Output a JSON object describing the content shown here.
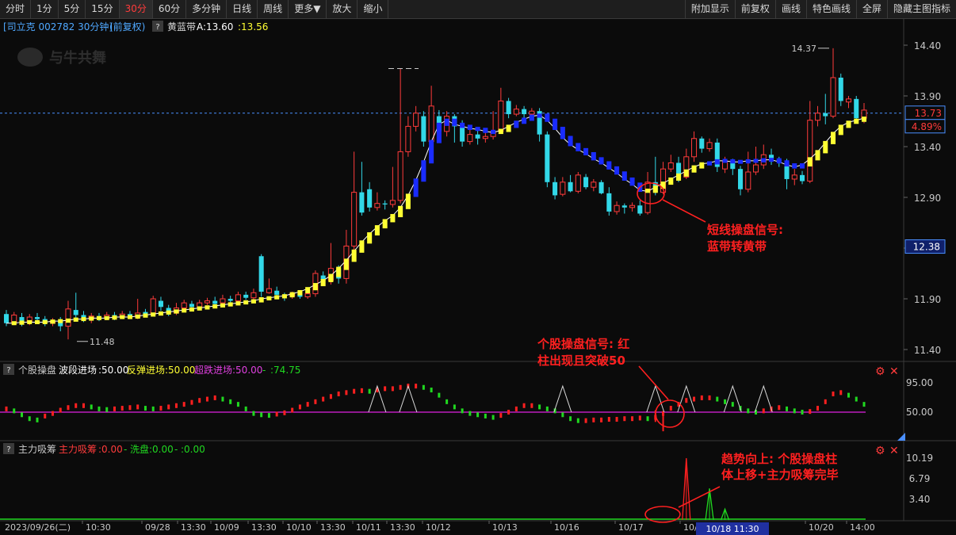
{
  "toolbar": {
    "left": [
      "分时",
      "1分",
      "5分",
      "15分",
      "30分",
      "60分",
      "多分钟",
      "日线",
      "周线",
      "更多▼",
      "放大",
      "缩小"
    ],
    "active": "30分",
    "right": [
      "附加显示",
      "前复权",
      "画线",
      "特色画线",
      "全屏",
      "隐藏主图指标"
    ]
  },
  "header": {
    "stock": "[司立克 002782 30分钟]",
    "adjust": "(前复权)",
    "qmark": "?",
    "indicator_name": "黄蓝带",
    "a_label": "A:13.60",
    "b_value": ":13.56"
  },
  "watermark": "与牛共舞",
  "price_axis": {
    "ticks": [
      "14.40",
      "13.90",
      "13.40",
      "12.90",
      "12.40",
      "11.90",
      "11.40"
    ],
    "current_price": "13.73",
    "change_pct": "4.89%",
    "marker_price": "12.38",
    "high_label": "14.37",
    "low_label": "11.48"
  },
  "osc_panel": {
    "qmark": "?",
    "name": "个股操盘",
    "p1_label": "波段进场",
    "p1_value": ":50.00",
    "p2_label": "反弹进场",
    "p2_value": ":50.00",
    "p3_label": "超跌进场",
    "p3_value": ":50.00",
    "p4_value": ":74.75",
    "ticks": [
      "95.00",
      "50.00"
    ]
  },
  "chip_panel": {
    "qmark": "?",
    "name": "主力吸筹",
    "p1_label": "主力吸筹",
    "p1_value": ":0.00",
    "p2_label": "洗盘",
    "p2_value": ":0.00",
    "p3_value": ":0.00",
    "ticks": [
      "10.19",
      "6.79",
      "3.40"
    ]
  },
  "x_axis": {
    "labels": [
      "2023/09/26(二)",
      "10:30",
      "09/28",
      "13:30",
      "10/09",
      "13:30",
      "10/10",
      "13:30",
      "10/11",
      "13:30",
      "10/12",
      "10/13",
      "10/16",
      "10/17",
      "10/18",
      "10/20",
      "14:00"
    ],
    "cursor": "10/18 11:30"
  },
  "annotations": {
    "a1_line1": "短线操盘信号:",
    "a1_line2": "蓝带转黄带",
    "a2_line1": "个股操盘信号: 红",
    "a2_line2": "柱出现且突破50",
    "a3_line1": "趋势向上: 个股操盘柱",
    "a3_line2": "体上移+主力吸筹完毕"
  },
  "colors": {
    "up": "#ff3b3b",
    "down": "#32d8e8",
    "yellow_band": "#ffff33",
    "blue_band": "#1a2cff",
    "annotation": "#ff2020",
    "osc_up": "#ff2020",
    "osc_down": "#20d820",
    "osc_line": "#e020e0",
    "chip_line": "#20d820"
  },
  "chart_data": {
    "type": "candlestick",
    "title": "司立克 002782 30分钟 (前复权)",
    "price_range": [
      11.3,
      14.45
    ],
    "candles": [
      [
        11.75,
        11.66,
        11.79,
        11.63
      ],
      [
        11.66,
        11.74,
        11.77,
        11.64
      ],
      [
        11.72,
        11.67,
        11.76,
        11.63
      ],
      [
        11.67,
        11.72,
        11.75,
        11.64
      ],
      [
        11.72,
        11.7,
        11.76,
        11.66
      ],
      [
        11.7,
        11.66,
        11.73,
        11.63
      ],
      [
        11.66,
        11.68,
        11.71,
        11.63
      ],
      [
        11.68,
        11.63,
        11.72,
        11.58
      ],
      [
        11.63,
        11.8,
        11.88,
        11.5
      ],
      [
        11.79,
        11.74,
        11.96,
        11.7
      ],
      [
        11.74,
        11.7,
        11.78,
        11.67
      ],
      [
        11.7,
        11.73,
        11.76,
        11.66
      ],
      [
        11.73,
        11.71,
        11.76,
        11.68
      ],
      [
        11.71,
        11.74,
        11.77,
        11.69
      ],
      [
        11.74,
        11.72,
        11.77,
        11.69
      ],
      [
        11.72,
        11.75,
        11.78,
        11.7
      ],
      [
        11.75,
        11.72,
        11.78,
        11.7
      ],
      [
        11.72,
        11.76,
        11.9,
        11.7
      ],
      [
        11.77,
        11.75,
        11.8,
        11.72
      ],
      [
        11.75,
        11.9,
        11.93,
        11.74
      ],
      [
        11.88,
        11.82,
        11.92,
        11.78
      ],
      [
        11.81,
        11.76,
        11.84,
        11.73
      ],
      [
        11.76,
        11.81,
        11.86,
        11.74
      ],
      [
        11.81,
        11.86,
        11.89,
        11.78
      ],
      [
        11.85,
        11.82,
        11.88,
        11.79
      ],
      [
        11.82,
        11.86,
        11.89,
        11.8
      ],
      [
        11.86,
        11.88,
        11.91,
        11.84
      ],
      [
        11.88,
        11.85,
        11.92,
        11.83
      ],
      [
        11.86,
        11.9,
        11.94,
        11.84
      ],
      [
        11.9,
        11.88,
        11.93,
        11.86
      ],
      [
        11.88,
        11.94,
        11.97,
        11.86
      ],
      [
        11.94,
        11.91,
        11.97,
        11.89
      ],
      [
        11.91,
        11.96,
        12.0,
        11.89
      ],
      [
        12.32,
        11.97,
        12.34,
        11.92
      ],
      [
        11.96,
        12.0,
        12.1,
        11.95
      ],
      [
        11.98,
        11.94,
        12.02,
        11.92
      ],
      [
        11.94,
        11.92,
        11.96,
        11.88
      ],
      [
        11.93,
        11.95,
        11.97,
        11.9
      ],
      [
        11.95,
        11.92,
        11.98,
        11.9
      ],
      [
        11.92,
        11.95,
        11.97,
        11.9
      ],
      [
        11.95,
        12.15,
        12.18,
        11.92
      ],
      [
        12.13,
        12.08,
        12.17,
        12.05
      ],
      [
        12.08,
        12.2,
        12.45,
        12.04
      ],
      [
        12.2,
        12.1,
        12.23,
        12.05
      ],
      [
        12.1,
        12.42,
        12.58,
        12.05
      ],
      [
        12.42,
        12.95,
        13.35,
        12.35
      ],
      [
        12.95,
        12.75,
        13.25,
        12.72
      ],
      [
        12.98,
        12.8,
        13.05,
        12.76
      ],
      [
        12.8,
        12.84,
        12.95,
        12.77
      ],
      [
        12.84,
        12.83,
        12.87,
        12.78
      ],
      [
        12.83,
        12.87,
        13.2,
        12.8
      ],
      [
        12.87,
        13.35,
        14.17,
        12.84
      ],
      [
        13.35,
        13.6,
        13.7,
        13.3
      ],
      [
        13.6,
        13.73,
        13.8,
        13.55
      ],
      [
        13.7,
        13.45,
        13.75,
        13.4
      ],
      [
        13.45,
        13.8,
        14.0,
        13.4
      ],
      [
        13.7,
        13.55,
        13.76,
        13.5
      ],
      [
        13.55,
        13.7,
        13.75,
        13.5
      ],
      [
        13.7,
        13.6,
        13.72,
        13.44
      ],
      [
        13.6,
        13.45,
        13.66,
        13.4
      ],
      [
        13.45,
        13.52,
        13.58,
        13.42
      ],
      [
        13.52,
        13.48,
        13.56,
        13.42
      ],
      [
        13.48,
        13.5,
        13.55,
        13.44
      ],
      [
        13.5,
        13.55,
        13.75,
        13.47
      ],
      [
        13.55,
        13.85,
        13.98,
        13.53
      ],
      [
        13.85,
        13.72,
        13.88,
        13.68
      ],
      [
        13.72,
        13.77,
        13.81,
        13.7
      ],
      [
        13.77,
        13.72,
        13.8,
        13.68
      ],
      [
        13.72,
        13.75,
        13.78,
        13.7
      ],
      [
        13.75,
        13.52,
        13.78,
        13.45
      ],
      [
        13.52,
        13.05,
        13.55,
        13.0
      ],
      [
        13.05,
        12.92,
        13.1,
        12.88
      ],
      [
        12.93,
        13.05,
        13.1,
        12.91
      ],
      [
        13.05,
        12.96,
        13.12,
        12.95
      ],
      [
        12.96,
        13.12,
        13.15,
        12.94
      ],
      [
        13.1,
        13.0,
        13.13,
        12.98
      ],
      [
        13.0,
        13.05,
        13.08,
        12.96
      ],
      [
        13.05,
        12.94,
        13.07,
        12.93
      ],
      [
        12.94,
        12.76,
        13.0,
        12.72
      ],
      [
        12.76,
        12.82,
        12.86,
        12.73
      ],
      [
        12.82,
        12.8,
        12.84,
        12.74
      ],
      [
        12.8,
        12.82,
        12.85,
        12.76
      ],
      [
        12.82,
        12.74,
        12.87,
        12.72
      ],
      [
        12.75,
        13.05,
        13.15,
        12.73
      ],
      [
        13.05,
        12.95,
        13.3,
        12.92
      ],
      [
        12.95,
        13.18,
        13.25,
        12.93
      ],
      [
        13.18,
        13.24,
        13.32,
        13.15
      ],
      [
        13.24,
        13.1,
        13.3,
        13.05
      ],
      [
        13.1,
        13.3,
        13.38,
        13.08
      ],
      [
        13.3,
        13.48,
        13.55,
        13.25
      ],
      [
        13.48,
        13.38,
        13.5,
        13.34
      ],
      [
        13.38,
        13.44,
        13.48,
        13.35
      ],
      [
        13.44,
        13.2,
        13.48,
        13.15
      ],
      [
        13.18,
        13.26,
        13.3,
        13.14
      ],
      [
        13.26,
        13.18,
        13.28,
        13.12
      ],
      [
        13.18,
        12.98,
        13.21,
        12.92
      ],
      [
        12.98,
        13.15,
        13.35,
        12.95
      ],
      [
        13.15,
        13.22,
        13.4,
        13.12
      ],
      [
        13.22,
        13.32,
        13.42,
        13.18
      ],
      [
        13.32,
        13.27,
        13.38,
        13.22
      ],
      [
        13.27,
        13.25,
        13.3,
        13.2
      ],
      [
        13.25,
        13.08,
        13.28,
        12.98
      ],
      [
        13.08,
        13.12,
        13.18,
        13.02
      ],
      [
        13.12,
        13.06,
        13.16,
        13.03
      ],
      [
        13.06,
        13.66,
        13.85,
        13.04
      ],
      [
        13.66,
        13.73,
        13.8,
        13.6
      ],
      [
        13.73,
        13.7,
        13.92,
        13.62
      ],
      [
        13.7,
        14.08,
        14.37,
        13.68
      ],
      [
        14.08,
        13.85,
        14.12,
        13.8
      ],
      [
        13.84,
        13.87,
        13.9,
        13.78
      ],
      [
        13.87,
        13.68,
        13.9,
        13.64
      ],
      [
        13.68,
        13.76,
        13.83,
        13.63
      ]
    ],
    "band": [
      11.66,
      11.66,
      11.67,
      11.67,
      11.67,
      11.67,
      11.68,
      11.68,
      11.69,
      11.7,
      11.7,
      11.71,
      11.71,
      11.71,
      11.72,
      11.72,
      11.72,
      11.73,
      11.74,
      11.75,
      11.76,
      11.77,
      11.78,
      11.79,
      11.8,
      11.81,
      11.82,
      11.83,
      11.84,
      11.85,
      11.86,
      11.87,
      11.88,
      11.9,
      11.91,
      11.92,
      11.93,
      11.95,
      11.97,
      12.0,
      12.04,
      12.08,
      12.13,
      12.2,
      12.28,
      12.37,
      12.46,
      12.54,
      12.61,
      12.67,
      12.72,
      12.8,
      12.92,
      13.07,
      13.25,
      13.45,
      13.62,
      13.66,
      13.62,
      13.6,
      13.58,
      13.57,
      13.55,
      13.54,
      13.56,
      13.6,
      13.64,
      13.67,
      13.7,
      13.71,
      13.66,
      13.58,
      13.49,
      13.42,
      13.37,
      13.33,
      13.28,
      13.24,
      13.19,
      13.14,
      13.08,
      13.03,
      12.97,
      12.96,
      13.0,
      13.04,
      13.08,
      13.12,
      13.16,
      13.2,
      13.23,
      13.24,
      13.26,
      13.26,
      13.25,
      13.25,
      13.26,
      13.26,
      13.27,
      13.27,
      13.25,
      13.22,
      13.2,
      13.22,
      13.28,
      13.35,
      13.44,
      13.53,
      13.6,
      13.64,
      13.66,
      13.68
    ],
    "band_blue_segments": [
      [
        53,
        63
      ],
      [
        66,
        82
      ],
      [
        91,
        98
      ],
      [
        99,
        103
      ]
    ],
    "osc_values": [
      55,
      52,
      46,
      40,
      38,
      44,
      48,
      53,
      57,
      60,
      60,
      58,
      55,
      54,
      55,
      56,
      57,
      58,
      56,
      55,
      56,
      58,
      60,
      62,
      65,
      68,
      70,
      72,
      70,
      66,
      62,
      55,
      48,
      46,
      45,
      47,
      49,
      53,
      58,
      62,
      66,
      70,
      74,
      78,
      80,
      82,
      83,
      82,
      84,
      86,
      86,
      88,
      90,
      90,
      88,
      84,
      76,
      66,
      58,
      52,
      48,
      46,
      44,
      42,
      45,
      50,
      55,
      60,
      60,
      58,
      55,
      52,
      46,
      40,
      37,
      37,
      38,
      38,
      39,
      39,
      40,
      40,
      41,
      40,
      42,
      48,
      56,
      62,
      68,
      70,
      72,
      72,
      70,
      66,
      62,
      56,
      52,
      50,
      52,
      55,
      57,
      55,
      52,
      50,
      51,
      56,
      66,
      78,
      80,
      76,
      70,
      62
    ],
    "osc_triangles": [
      48,
      52,
      72,
      84,
      88,
      94,
      98
    ],
    "chip_spikes": [
      {
        "i": 88,
        "h": 10.19,
        "c": "red"
      },
      {
        "i": 91,
        "h": 5.2,
        "c": "green"
      },
      {
        "i": 93,
        "h": 1.8,
        "c": "green"
      }
    ],
    "chip_ylim": [
      0,
      11
    ]
  }
}
